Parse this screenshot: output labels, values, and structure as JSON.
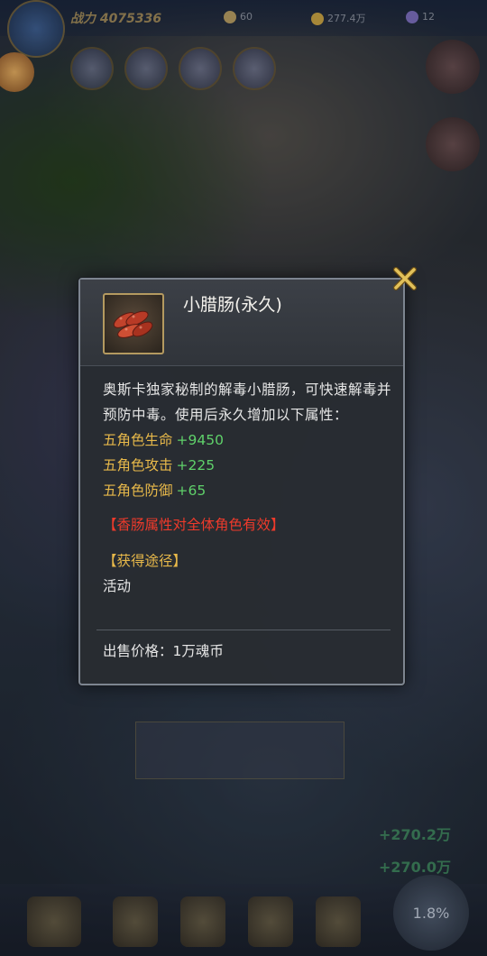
{
  "hud": {
    "power_label": "战力 4075336",
    "resource_1": "60",
    "resource_2": "277.4万",
    "resource_3": "12",
    "percent": "1.8%",
    "gain_1": "+270.2万",
    "gain_2": "+270.0万"
  },
  "tooltip": {
    "title": "小腊肠(永久)",
    "description": "奥斯卡独家秘制的解毒小腊肠，可快速解毒并预防中毒。使用后永久增加以下属性：",
    "stats": [
      {
        "name": "五角色生命",
        "value": "+9450"
      },
      {
        "name": "五角色攻击",
        "value": "+225"
      },
      {
        "name": "五角色防御",
        "value": "+65"
      }
    ],
    "notice": "【香肠属性对全体角色有效】",
    "source_title": "【获得途径】",
    "source_value": "活动",
    "price": "出售价格：1万魂币"
  },
  "colors": {
    "stat_name": "#e8b94a",
    "stat_value": "#5fd16a",
    "notice": "#ee3a2b",
    "close_icon": "#e2c15a"
  },
  "icons": {
    "item": "sausage-icon",
    "close": "close-icon"
  }
}
